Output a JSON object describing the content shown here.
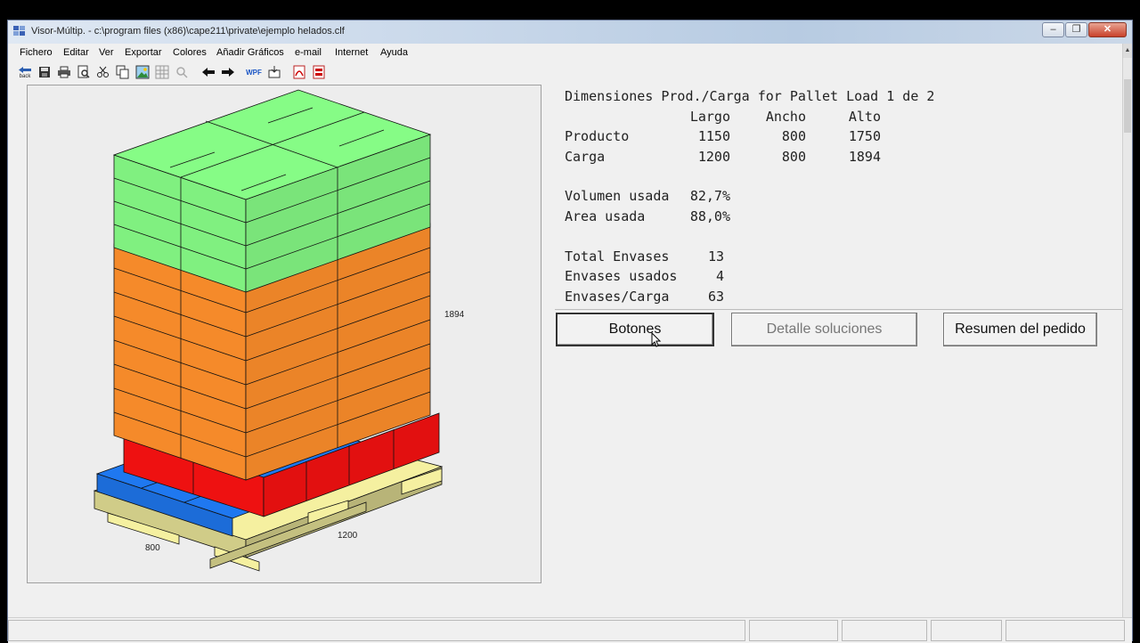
{
  "window": {
    "title": "Visor-Múltip. - c:\\program files (x86)\\cape211\\private\\ejemplo helados.clf",
    "minimize_glyph": "‒",
    "maximize_glyph": "❐",
    "close_glyph": "✕"
  },
  "menu": [
    "Fichero",
    "Editar",
    "Ver",
    "Exportar",
    "Colores",
    "Añadir Gráficos",
    "e-mail",
    "Internet",
    "Ayuda"
  ],
  "toolbar": {
    "back_label": "back",
    "wpf_label": "WPF"
  },
  "drawing": {
    "height_label": "1894",
    "length_label": "1200",
    "width_label": "800",
    "colors": {
      "top_layer": "#80f080",
      "middle_layer": "#f58a2a",
      "red_layer": "#ee1111",
      "blue_layer": "#1f78f0",
      "pallet": "#f5f0a0"
    }
  },
  "info": {
    "heading": "Dimensiones Prod./Carga for Pallet Load 1 de 2",
    "columns": [
      "Largo",
      "Ancho",
      "Alto"
    ],
    "rows": [
      {
        "label": "Producto",
        "largo": "1150",
        "ancho": "800",
        "alto": "1750"
      },
      {
        "label": "Carga",
        "largo": "1200",
        "ancho": "800",
        "alto": "1894"
      }
    ],
    "volumen_label": "Volumen usada",
    "volumen_value": "82,7%",
    "area_label": "Area usada",
    "area_value": "88,0%",
    "total_label": "Total Envases",
    "total_value": "13",
    "usados_label": "Envases usados",
    "usados_value": "4",
    "carga_label": "Envases/Carga",
    "carga_value": "63"
  },
  "buttons": {
    "botones": "Botones",
    "detalle": "Detalle soluciones",
    "resumen": "Resumen del pedido"
  }
}
